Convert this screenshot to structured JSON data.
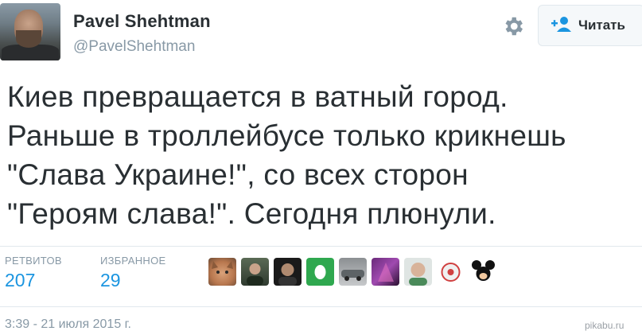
{
  "user": {
    "name": "Pavel Shehtman",
    "handle": "@PavelShehtman"
  },
  "follow_button": {
    "label": "Читать",
    "icon": "follow-user-icon"
  },
  "settings_icon": "gear-icon",
  "tweet": {
    "lines": [
      "Киев превращается в ватный город.",
      "Раньше в троллейбусе только крикнешь",
      "\"Слава Украине!\", со всех сторон",
      "\"Героям слава!\". Сегодня плюнули."
    ]
  },
  "stats": {
    "retweets_label": "РЕТВИТОВ",
    "retweets_value": "207",
    "favorites_label": "ИЗБРАННОЕ",
    "favorites_value": "29"
  },
  "favorited_by_avatars": [
    "cat-avatar",
    "man-avatar",
    "dark-avatar",
    "green-egg-avatar",
    "car-avatar",
    "purple-avatar",
    "bald-man-avatar",
    "mascot-avatar",
    "mickey-avatar"
  ],
  "timestamp": "3:39 - 21 июля 2015 г.",
  "watermark": "pikabu.ru",
  "colors": {
    "accent": "#1b95e0",
    "muted": "#8899a6",
    "text": "#292f33"
  }
}
